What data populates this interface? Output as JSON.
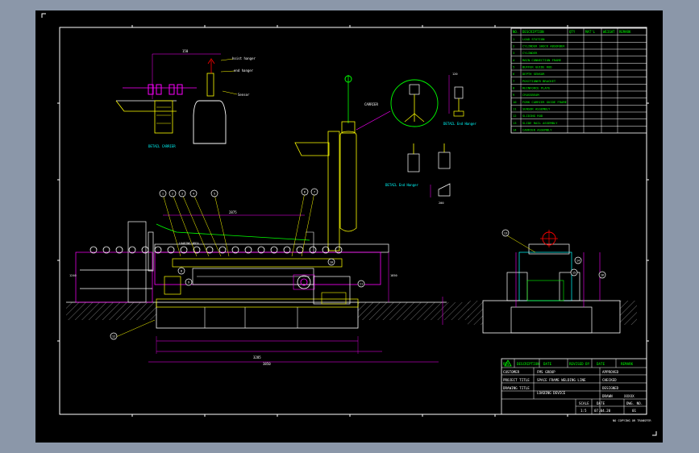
{
  "drawing": {
    "notes": {
      "hoist_hanger": "hoist hanger",
      "end_hanger": "end hanger",
      "sensor": "Sensor",
      "loading_area": "LOADING AREA",
      "station_label": "CARRIER"
    },
    "captions": {
      "detail_carrier": "DETAIL CARRIER",
      "detail_end_hanger_1": "DETAIL End Hanger",
      "detail_end_hanger_2": "DETAIL End Hanger"
    },
    "dimensions": {
      "top_length": "2875",
      "overall_length": "3850",
      "base_length": "3285",
      "side_height": "1850",
      "left_height": "1240",
      "d1": "200",
      "d2": "120",
      "d3": "150",
      "d4": "200"
    },
    "balloons": [
      "1",
      "2",
      "3",
      "4",
      "5",
      "6",
      "7",
      "8",
      "9",
      "10",
      "11",
      "12",
      "13",
      "14",
      "15",
      "16"
    ],
    "parts_table": {
      "headers": [
        "NO.",
        "DESCRIPTION",
        "QTY",
        "MAT'L",
        "WEIGHT",
        "REMARK"
      ],
      "rows": [
        [
          "1",
          "LOAD STATION"
        ],
        [
          "2",
          "CYLINDER SHOCK ABSORBER"
        ],
        [
          "3",
          "CYLINDER"
        ],
        [
          "4",
          "MAIN CONNECTION FRAME"
        ],
        [
          "5",
          "BUFFER GUIDE ROD"
        ],
        [
          "6",
          "DEPTH SENSOR"
        ],
        [
          "7",
          "POSITIONER BRACKET"
        ],
        [
          "8",
          "REINFORCE PLATE"
        ],
        [
          "9",
          "CROSSBEAM"
        ],
        [
          "10",
          "FORK CARRIER GUIDE FRAME"
        ],
        [
          "11",
          "SENSOR ASSEMBLY"
        ],
        [
          "12",
          "SLIDING ROD"
        ],
        [
          "13",
          "SLIDE RAIL ASSEMBLY"
        ],
        [
          "14",
          "CARRIER ASSEMBLY"
        ]
      ]
    },
    "title_block": {
      "revision_headers": [
        "REV",
        "DESCRIPTION",
        "DATE",
        "REVISED BY",
        "DATE",
        "REMARK"
      ],
      "customer_label": "CUSTOMER",
      "customer_value": "FMS GROUP",
      "project_label": "PROJECT TITLE",
      "project_value": "SPACE FRAME WELDING LINE",
      "drawing_label": "DRAWING TITLE",
      "drawing_value": "LOADING DEVICE",
      "approved": "APPROVED",
      "checked": "CHECKED",
      "designed": "DESIGNED",
      "drawn": "DRAWN",
      "drawn_value": "XXXXX",
      "scale_label": "SCALE",
      "scale_value": "1:5",
      "date_label": "DATE",
      "date_value": "07.04.20",
      "dwg_label": "DWG. NO.",
      "dwg_value": "01",
      "footer_note": "NO COPYING OR TRANSFER"
    }
  }
}
